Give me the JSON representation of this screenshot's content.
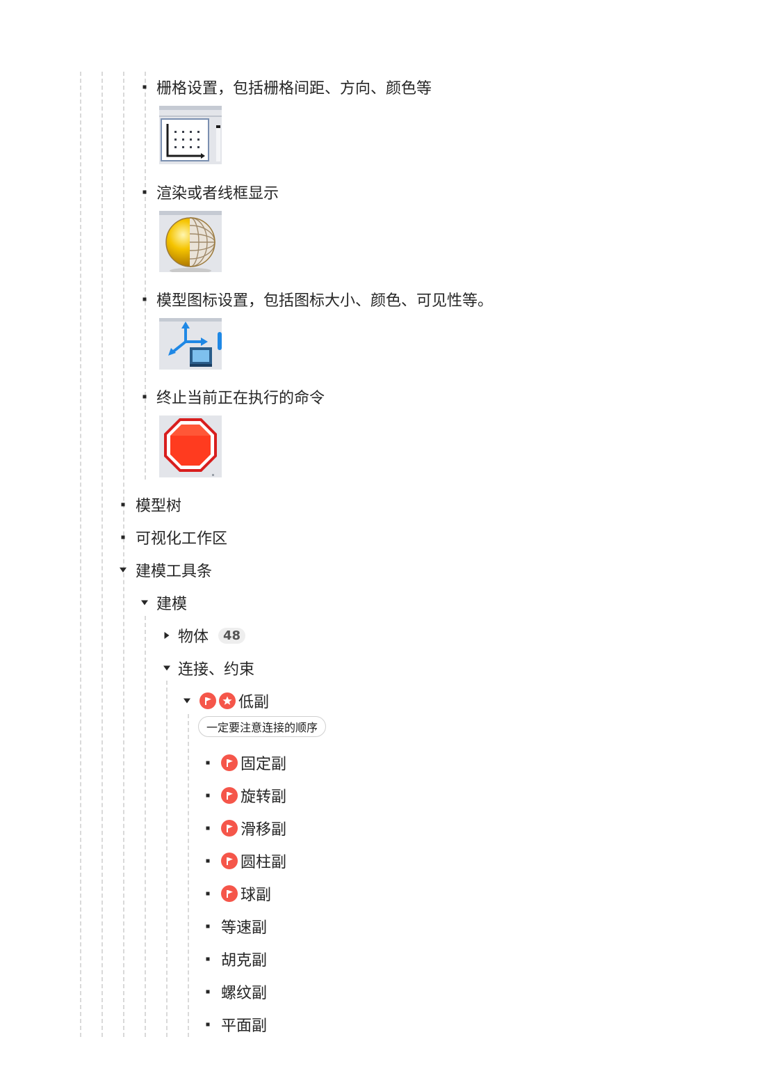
{
  "tree": {
    "settings_items": [
      {
        "label": "栅格设置，包括栅格间距、方向、颜色等",
        "icon": "grid-settings-icon"
      },
      {
        "label": "渲染或者线框显示",
        "icon": "render-wireframe-sphere-icon"
      },
      {
        "label": "模型图标设置，包括图标大小、颜色、可见性等。",
        "icon": "model-icon-settings-axes-icon"
      },
      {
        "label": "终止当前正在执行的命令",
        "icon": "stop-octagon-icon"
      }
    ],
    "model_tree": "模型树",
    "viz_area": "可视化工作区",
    "modeling_toolbar": "建模工具条",
    "modeling": "建模",
    "body": {
      "label": "物体",
      "count": "48"
    },
    "connections": "连接、约束",
    "lower_pair": {
      "label": "低副",
      "note": "一定要注意连接的顺序"
    },
    "pairs": [
      "固定副",
      "旋转副",
      "滑移副",
      "圆柱副",
      "球副",
      "等速副",
      "胡克副",
      "螺纹副",
      "平面副"
    ]
  },
  "colors": {
    "flag_red": "#f5564a",
    "guide": "#d9d9d9",
    "text": "#262626"
  }
}
